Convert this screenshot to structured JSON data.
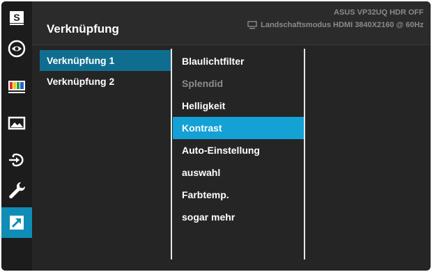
{
  "header": {
    "title": "Verknüpfung",
    "status_line1": "ASUS  VP32UQ  HDR OFF",
    "status_line2": "Landschaftsmodus HDMI 3840X2160 @ 60Hz"
  },
  "iconbar": {
    "items": [
      {
        "icon": "splendid-s-icon",
        "label": "S"
      },
      {
        "icon": "eye-blue-light-icon"
      },
      {
        "icon": "color-bars-icon"
      },
      {
        "icon": "image-landscape-icon"
      },
      {
        "icon": "input-select-icon"
      },
      {
        "icon": "wrench-system-icon"
      },
      {
        "icon": "shortcut-arrow-icon",
        "active": true
      }
    ]
  },
  "menu_level1": {
    "items": [
      {
        "label": "Verknüpfung 1",
        "selected": true
      },
      {
        "label": "Verknüpfung 2"
      }
    ]
  },
  "menu_level2": {
    "items": [
      {
        "label": "Blaulichtfilter"
      },
      {
        "label": "Splendid",
        "dimmed": true
      },
      {
        "label": "Helligkeit"
      },
      {
        "label": "Kontrast",
        "selected": true
      },
      {
        "label": "Auto-Einstellung"
      },
      {
        "label": "auswahl"
      },
      {
        "label": "Farbtemp."
      },
      {
        "label": "sogar mehr"
      }
    ]
  },
  "colors": {
    "background": "#252525",
    "sidebar_active": "#0f8db6",
    "level1_selected": "#0f6e90",
    "level2_selected": "#13a1d6",
    "dim_text": "#8c8c8c"
  }
}
